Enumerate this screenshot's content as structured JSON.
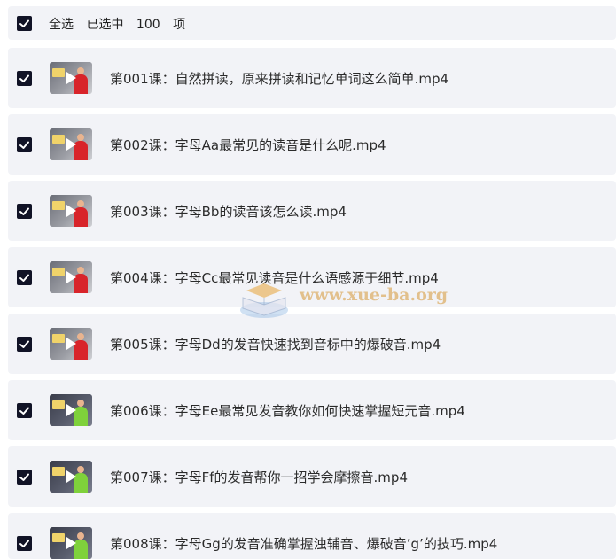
{
  "header": {
    "select_all_label": "全选",
    "selected_prefix": "已选中",
    "selected_count": "100",
    "selected_suffix": "项"
  },
  "files": [
    {
      "name": "第001课：自然拼读，原来拼读和记忆单词这么简单.mp4",
      "checked": true
    },
    {
      "name": "第002课：字母Aa最常见的读音是什么呢.mp4",
      "checked": true
    },
    {
      "name": "第003课：字母Bb的读音该怎么读.mp4",
      "checked": true
    },
    {
      "name": "第004课：字母Cc最常见读音是什么语感源于细节.mp4",
      "checked": true
    },
    {
      "name": "第005课：字母Dd的发音快速找到音标中的爆破音.mp4",
      "checked": true
    },
    {
      "name": "第006课：字母Ee最常见发音教你如何快速掌握短元音.mp4",
      "checked": true
    },
    {
      "name": "第007课：字母Ff的发音帮你一招学会摩擦音.mp4",
      "checked": true
    },
    {
      "name": "第008课：字母Gg的发音准确掌握浊辅音、爆破音’g’的技巧.mp4",
      "checked": true
    }
  ],
  "watermark": {
    "text": "www.xue-ba.org"
  },
  "colors": {
    "row_background": "#f2f3f7",
    "checkbox_fill": "#111326",
    "watermark": "#d69634"
  }
}
